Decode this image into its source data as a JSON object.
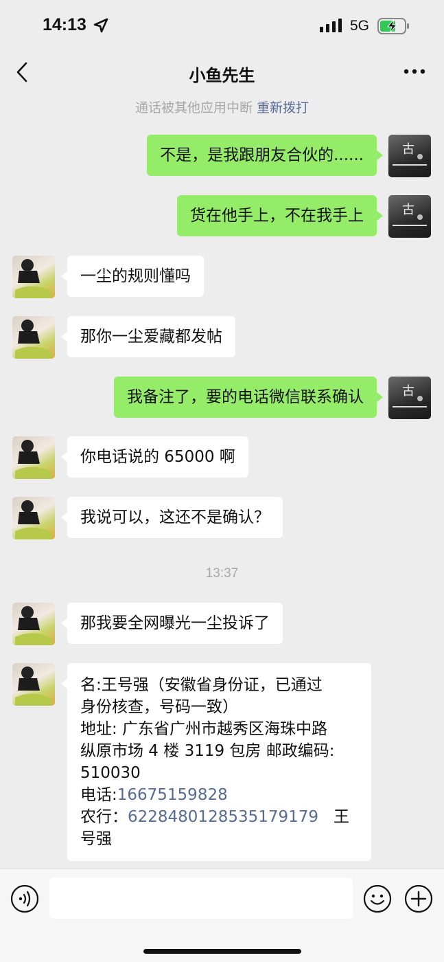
{
  "status_bar": {
    "time": "14:13",
    "network": "5G",
    "icons": [
      "location-arrow-icon",
      "signal-icon",
      "battery-charging-icon"
    ]
  },
  "nav": {
    "title": "小鱼先生",
    "icons": [
      "back-chevron-icon",
      "more-icon"
    ]
  },
  "system_notice": {
    "text": "通话被其他应用中断",
    "action": "重新拨打"
  },
  "messages": [
    {
      "sender": "me",
      "text": "不是，是我跟朋友合伙的......"
    },
    {
      "sender": "me",
      "text": "货在他手上，不在我手上"
    },
    {
      "sender": "other",
      "text": "一尘的规则懂吗"
    },
    {
      "sender": "other",
      "text": "那你一尘爱藏都发帖"
    },
    {
      "sender": "me",
      "text": "我备注了，要的电话微信联系确认"
    },
    {
      "sender": "other",
      "text": "你电话说的 65000 啊"
    },
    {
      "sender": "other",
      "text": "我说可以，这还不是确认？"
    }
  ],
  "timestamp": "13:37",
  "messages_after": [
    {
      "sender": "other",
      "text": "那我要全网曝光一尘投诉了"
    }
  ],
  "info_message": {
    "sender": "other",
    "name_line_1": "名:王号强（安徽省身份证，已通过",
    "name_line_2": "身份核查，号码一致）",
    "address_line_1": "地址: 广东省广州市越秀区海珠中路",
    "address_line_2": "纵原市场 4 楼 3119 包房  邮政编码:",
    "postcode": "510030",
    "phone_label": "电话:",
    "phone": "16675159828",
    "bank_label": "农行：",
    "bank_account": "6228480128535179179",
    "bank_name_1": "王",
    "bank_name_2": "号强"
  },
  "input_bar": {
    "placeholder": "",
    "icons": [
      "voice-icon",
      "emoji-icon",
      "plus-icon"
    ]
  },
  "colors": {
    "background": "#ededed",
    "my_bubble": "#95ec69",
    "other_bubble": "#ffffff",
    "link": "#576b95",
    "muted_text": "#a8a8a8"
  }
}
